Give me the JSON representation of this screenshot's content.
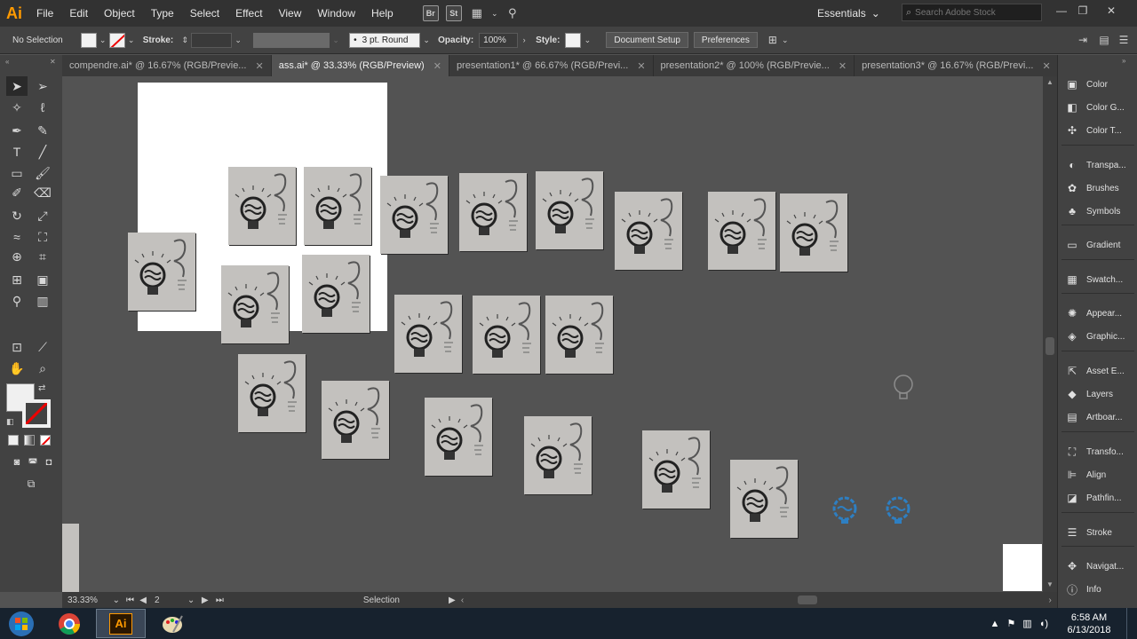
{
  "app": {
    "logo": "Ai",
    "colors": {
      "accent": "#ff9a00",
      "chrome": "#323232",
      "canvas": "#535353"
    }
  },
  "menu": {
    "items": [
      "File",
      "Edit",
      "Object",
      "Type",
      "Select",
      "Effect",
      "View",
      "Window",
      "Help"
    ],
    "bridge": "Br",
    "stock": "St"
  },
  "workspace": {
    "label": "Essentials"
  },
  "search": {
    "placeholder": "Search Adobe Stock"
  },
  "controlbar": {
    "selection": "No Selection",
    "stroke_label": "Stroke:",
    "brush": "3 pt. Round",
    "opacity_label": "Opacity:",
    "opacity_value": "100%",
    "style_label": "Style:",
    "document_setup": "Document Setup",
    "preferences": "Preferences"
  },
  "tabs": [
    {
      "label": "compendre.ai* @ 16.67% (RGB/Previe...",
      "active": false
    },
    {
      "label": "ass.ai* @ 33.33% (RGB/Preview)",
      "active": true
    },
    {
      "label": "presentation1* @ 66.67% (RGB/Previ...",
      "active": false
    },
    {
      "label": "presentation2* @ 100% (RGB/Previe...",
      "active": false
    },
    {
      "label": "presentation3* @ 16.67% (RGB/Previ...",
      "active": false
    }
  ],
  "status": {
    "zoom": "33.33%",
    "artboard": "2",
    "tool": "Selection"
  },
  "panels": [
    {
      "label": "Color",
      "icon": "color-icon"
    },
    {
      "label": "Color G...",
      "icon": "color-guide-icon"
    },
    {
      "label": "Color T...",
      "icon": "color-themes-icon"
    },
    {
      "label": "Transpa...",
      "icon": "transparency-icon"
    },
    {
      "label": "Brushes",
      "icon": "brushes-icon"
    },
    {
      "label": "Symbols",
      "icon": "symbols-icon"
    },
    {
      "label": "Gradient",
      "icon": "gradient-icon"
    },
    {
      "label": "Swatch...",
      "icon": "swatches-icon"
    },
    {
      "label": "Appear...",
      "icon": "appearance-icon"
    },
    {
      "label": "Graphic...",
      "icon": "graphic-styles-icon"
    },
    {
      "label": "Asset E...",
      "icon": "asset-export-icon"
    },
    {
      "label": "Layers",
      "icon": "layers-icon"
    },
    {
      "label": "Artboar...",
      "icon": "artboards-icon"
    },
    {
      "label": "Transfo...",
      "icon": "transform-icon"
    },
    {
      "label": "Align",
      "icon": "align-icon"
    },
    {
      "label": "Pathfin...",
      "icon": "pathfinder-icon"
    },
    {
      "label": "Stroke",
      "icon": "stroke-icon"
    },
    {
      "label": "Navigat...",
      "icon": "navigator-icon"
    },
    {
      "label": "Info",
      "icon": "info-icon"
    }
  ],
  "taskbar": {
    "time": "6:58 AM",
    "date": "6/13/2018"
  }
}
